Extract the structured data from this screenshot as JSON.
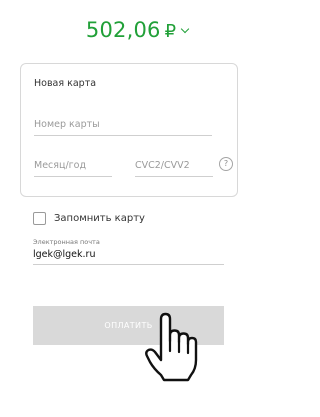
{
  "payment": {
    "amount": "502,06",
    "currency_symbol": "₽"
  },
  "card_form": {
    "title": "Новая карта",
    "card_number_placeholder": "Номер карты",
    "expiry_placeholder": "Месяц/год",
    "cvc_placeholder": "CVC2/CVV2",
    "help_icon_glyph": "?"
  },
  "remember": {
    "label": "Запомнить карту",
    "checked": false
  },
  "email": {
    "label": "Электронная почта",
    "value": "lgek@lgek.ru"
  },
  "pay_button": {
    "label": "ОПЛАТИТЬ"
  },
  "colors": {
    "accent_green": "#21a038",
    "button_disabled": "#d9d9d9"
  },
  "icons": [
    "chevron-down-icon",
    "help-icon",
    "checkbox-icon",
    "hand-cursor-icon"
  ]
}
